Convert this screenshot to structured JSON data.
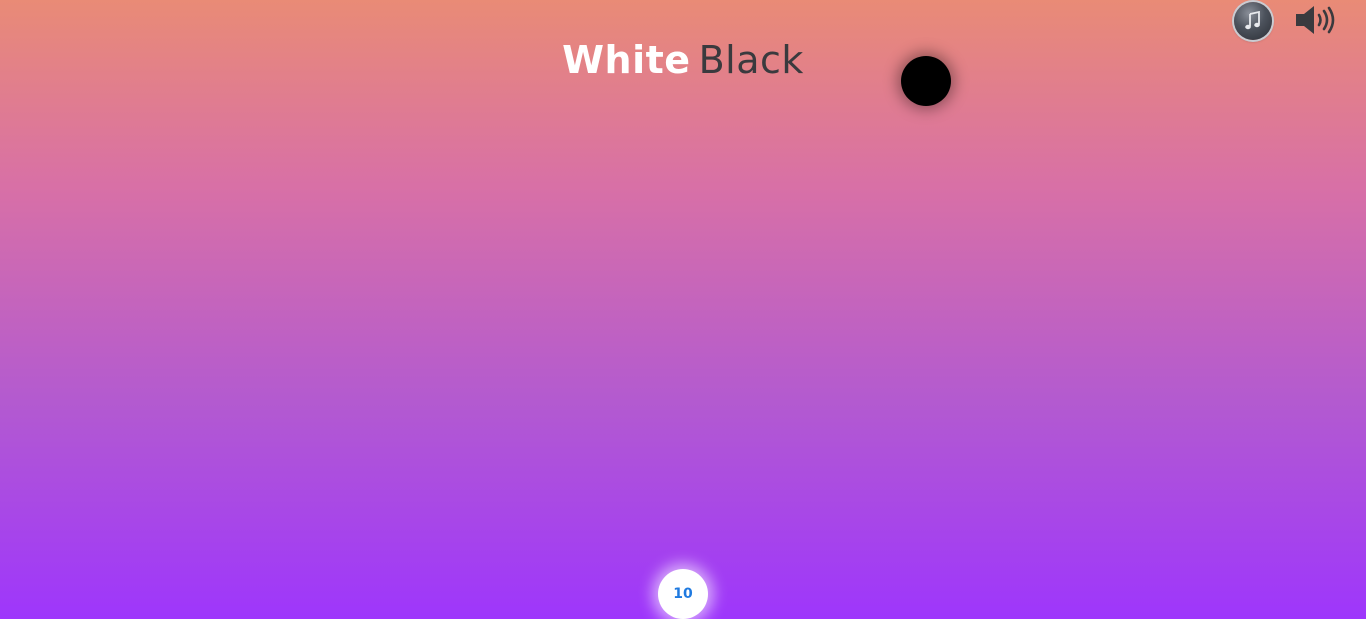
{
  "title": {
    "white_word": "White",
    "black_word": "Black"
  },
  "controls": {
    "music_icon": "music-note-icon",
    "sound_icon": "speaker-volume-icon"
  },
  "player": {
    "score": "10"
  },
  "colors": {
    "gradient_top": "#e98b76",
    "gradient_bottom": "#9e36fc",
    "title_white": "#ffffff",
    "title_black": "#3a3a3e",
    "score_text": "#1f7ae0"
  }
}
